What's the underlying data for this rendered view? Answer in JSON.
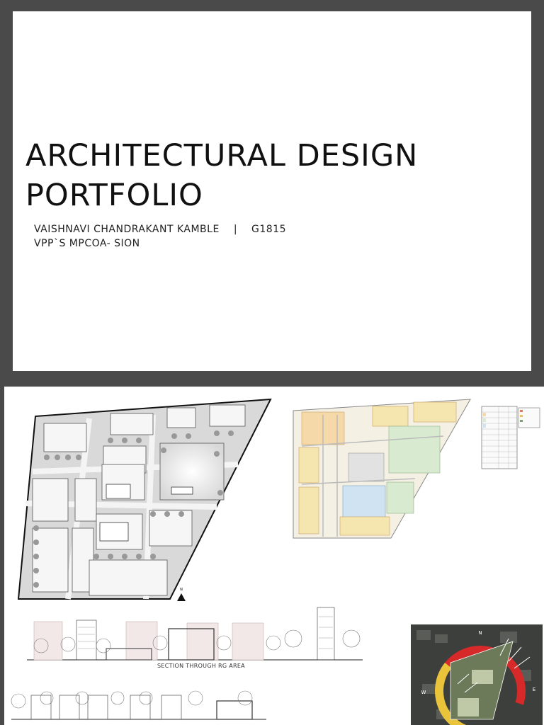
{
  "cover": {
    "title_line1": "ARCHITECTURAL DESIGN",
    "title_line2": "PORTFOLIO",
    "author": "VAISHNAVI CHANDRAKANT KAMBLE",
    "separator": "|",
    "id": "G1815",
    "institution": "VPP`S MPCOA- SION"
  },
  "sheet": {
    "north_label": "N",
    "section_caption": "SECTION THROUGH RG AREA",
    "compass": {
      "n": "N",
      "w": "W",
      "e": "E"
    }
  }
}
